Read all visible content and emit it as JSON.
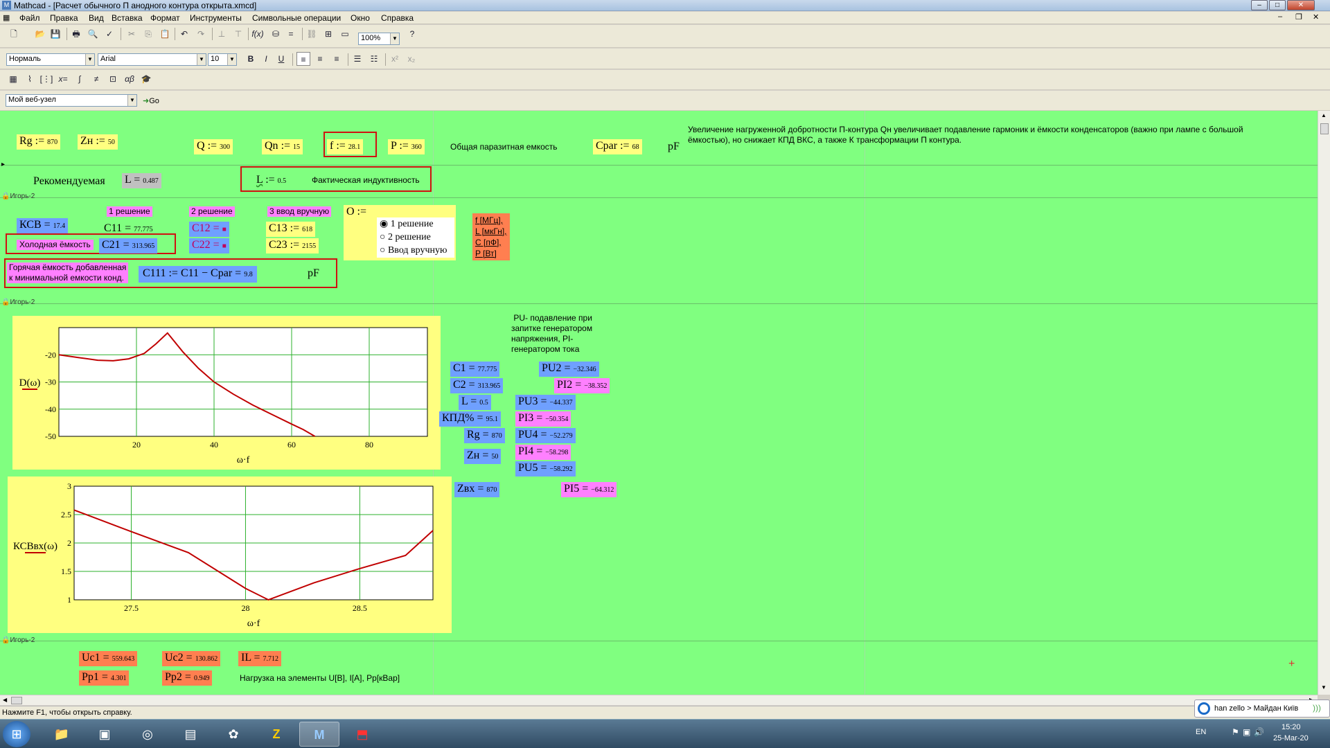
{
  "window": {
    "title": "Mathcad - [Расчет обычного П анодного контура открыта.xmcd]"
  },
  "menu": [
    "Файл",
    "Правка",
    "Вид",
    "Вставка",
    "Формат",
    "Инструменты",
    "Символьные операции",
    "Окно",
    "Справка"
  ],
  "toolbar": {
    "zoom": "100%",
    "style": "Нормаль",
    "font": "Arial",
    "size": "10",
    "web": "Мой веб-узел",
    "go": "Go"
  },
  "doc": {
    "rg": {
      "name": "Rg",
      "op": ":=",
      "val": "870"
    },
    "zh": {
      "name": "Zн",
      "op": ":=",
      "val": "50"
    },
    "q": {
      "name": "Q",
      "op": ":=",
      "val": "300"
    },
    "qn": {
      "name": "Qn",
      "op": ":=",
      "val": "15"
    },
    "f": {
      "name": "f",
      "op": ":=",
      "val": "28.1"
    },
    "p": {
      "name": "P",
      "op": ":=",
      "val": "360"
    },
    "cpar_label": "Общая паразитная емкость",
    "cpar": {
      "name": "Cpar",
      "op": ":=",
      "val": "68"
    },
    "pf": "pF",
    "note_top": "Увеличение нагруженной добротности П-контура Qн увеличивает подавление гармоник и ёмкости конденсаторов (важно при лампе с большой ёмкостью), но снижает КПД ВКС, а также К трансформации П контура.",
    "recommended": "Рекомендуемая",
    "l_rec": {
      "name": "L",
      "op": "=",
      "val": "0.487"
    },
    "l_act": {
      "name": "L",
      "op": ":=",
      "val": "0.5"
    },
    "l_act_label": "Фактическая индуктивность",
    "region_label": "Игорь-2",
    "ksv": {
      "name": "КСВ",
      "op": "=",
      "val": "17.4"
    },
    "sol1": "1 решение",
    "sol2": "2 решение",
    "sol3": "3 ввод вручную",
    "c11": {
      "name": "C11",
      "op": "=",
      "val": "77.775"
    },
    "c12": {
      "name": "C12",
      "op": "=",
      "val": "■"
    },
    "c13": {
      "name": "C13",
      "op": ":=",
      "val": "618"
    },
    "cold": "Холодная ёмкость",
    "c21": {
      "name": "C21",
      "op": "=",
      "val": "313.965"
    },
    "c22": {
      "name": "C22",
      "op": "=",
      "val": "■"
    },
    "c23": {
      "name": "C23",
      "op": ":=",
      "val": "2155"
    },
    "o_label": "O :=",
    "radios": [
      {
        "label": "1 решение",
        "checked": true
      },
      {
        "label": "2 решение",
        "checked": false
      },
      {
        "label": "Ввод вручную",
        "checked": false
      }
    ],
    "units": [
      "f [МГц],",
      "L [мкГн],",
      "C [пФ],",
      "P [Вт]"
    ],
    "hot1": "Горячая ёмкость добавленная",
    "hot2": "к минимальной емкости конд.",
    "c111": {
      "name": "C111 := C11 − Cpar",
      "op": "=",
      "val": "9.8"
    },
    "pu_note": [
      "PU- подавление при",
      "запитке генератором",
      "напряжения, PI-",
      "генератором тока"
    ],
    "c1": {
      "name": "C1",
      "op": "=",
      "val": "77.775"
    },
    "c2": {
      "name": "C2",
      "op": "=",
      "val": "313.965"
    },
    "l2": {
      "name": "L",
      "op": "=",
      "val": "0.5"
    },
    "kpd": {
      "name": "КПД%",
      "op": "=",
      "val": "95.1"
    },
    "rg2": {
      "name": "Rg",
      "op": "=",
      "val": "870"
    },
    "zh2": {
      "name": "Zн",
      "op": "=",
      "val": "50"
    },
    "zbx": {
      "name": "Zвх",
      "op": "=",
      "val": "870"
    },
    "pu2": {
      "name": "PU2",
      "op": "=",
      "val": "−32.346"
    },
    "pi2": {
      "name": "PI2",
      "op": "=",
      "val": "−38.352"
    },
    "pu3": {
      "name": "PU3",
      "op": "=",
      "val": "−44.337"
    },
    "pi3": {
      "name": "PI3",
      "op": "=",
      "val": "−50.354"
    },
    "pu4": {
      "name": "PU4",
      "op": "=",
      "val": "−52.279"
    },
    "pi4": {
      "name": "PI4",
      "op": "=",
      "val": "−58.298"
    },
    "pu5": {
      "name": "PU5",
      "op": "=",
      "val": "−58.292"
    },
    "pi5": {
      "name": "PI5",
      "op": "=",
      "val": "−64.312"
    },
    "uc1": {
      "name": "Uc1",
      "op": "=",
      "val": "559.643"
    },
    "uc2": {
      "name": "Uc2",
      "op": "=",
      "val": "130.862"
    },
    "il": {
      "name": "IL",
      "op": "=",
      "val": "7.712"
    },
    "pp1": {
      "name": "Pp1",
      "op": "=",
      "val": "4.301"
    },
    "pp2": {
      "name": "Pp2",
      "op": "=",
      "val": "0.949"
    },
    "load_note": "Нагрузка на элементы U[В], I[А], Pp[кВар]"
  },
  "chart_data": [
    {
      "type": "line",
      "ylabel": "D(ω)",
      "xlabel": "ω·f",
      "xlim": [
        0,
        95
      ],
      "ylim": [
        -50,
        -10
      ],
      "xticks": [
        20,
        40,
        60,
        80
      ],
      "yticks": [
        -20,
        -30,
        -40,
        -50
      ],
      "grid": true,
      "series": [
        {
          "color": "#c00000",
          "x": [
            0,
            5,
            10,
            14,
            18,
            22,
            25,
            28,
            32,
            36,
            40,
            45,
            50,
            55,
            60,
            63,
            66
          ],
          "y": [
            -20,
            -21,
            -22,
            -22.2,
            -21.5,
            -19.5,
            -16,
            -12,
            -19,
            -25,
            -30,
            -34.5,
            -38.5,
            -42,
            -45.5,
            -47.5,
            -50
          ]
        }
      ]
    },
    {
      "type": "line",
      "ylabel": "КСВвх(ω)",
      "xlabel": "ω·f",
      "xlim": [
        27.25,
        28.82
      ],
      "ylim": [
        1,
        3
      ],
      "xticks": [
        27.5,
        28,
        28.5
      ],
      "yticks": [
        3,
        2.5,
        2,
        1.5,
        1
      ],
      "grid": true,
      "series": [
        {
          "color": "#c00000",
          "x": [
            27.25,
            27.5,
            27.75,
            28,
            28.1,
            28.3,
            28.5,
            28.7,
            28.82
          ],
          "y": [
            2.58,
            2.2,
            1.83,
            1.2,
            1,
            1.3,
            1.55,
            1.78,
            2.22
          ]
        }
      ]
    }
  ],
  "status": {
    "text": "Нажмите F1, чтобы открыть справку.",
    "chat": "han zello > Майдан Київ"
  },
  "tray": {
    "lang": "EN",
    "time": "15:20",
    "date": "25-Mar-20"
  }
}
